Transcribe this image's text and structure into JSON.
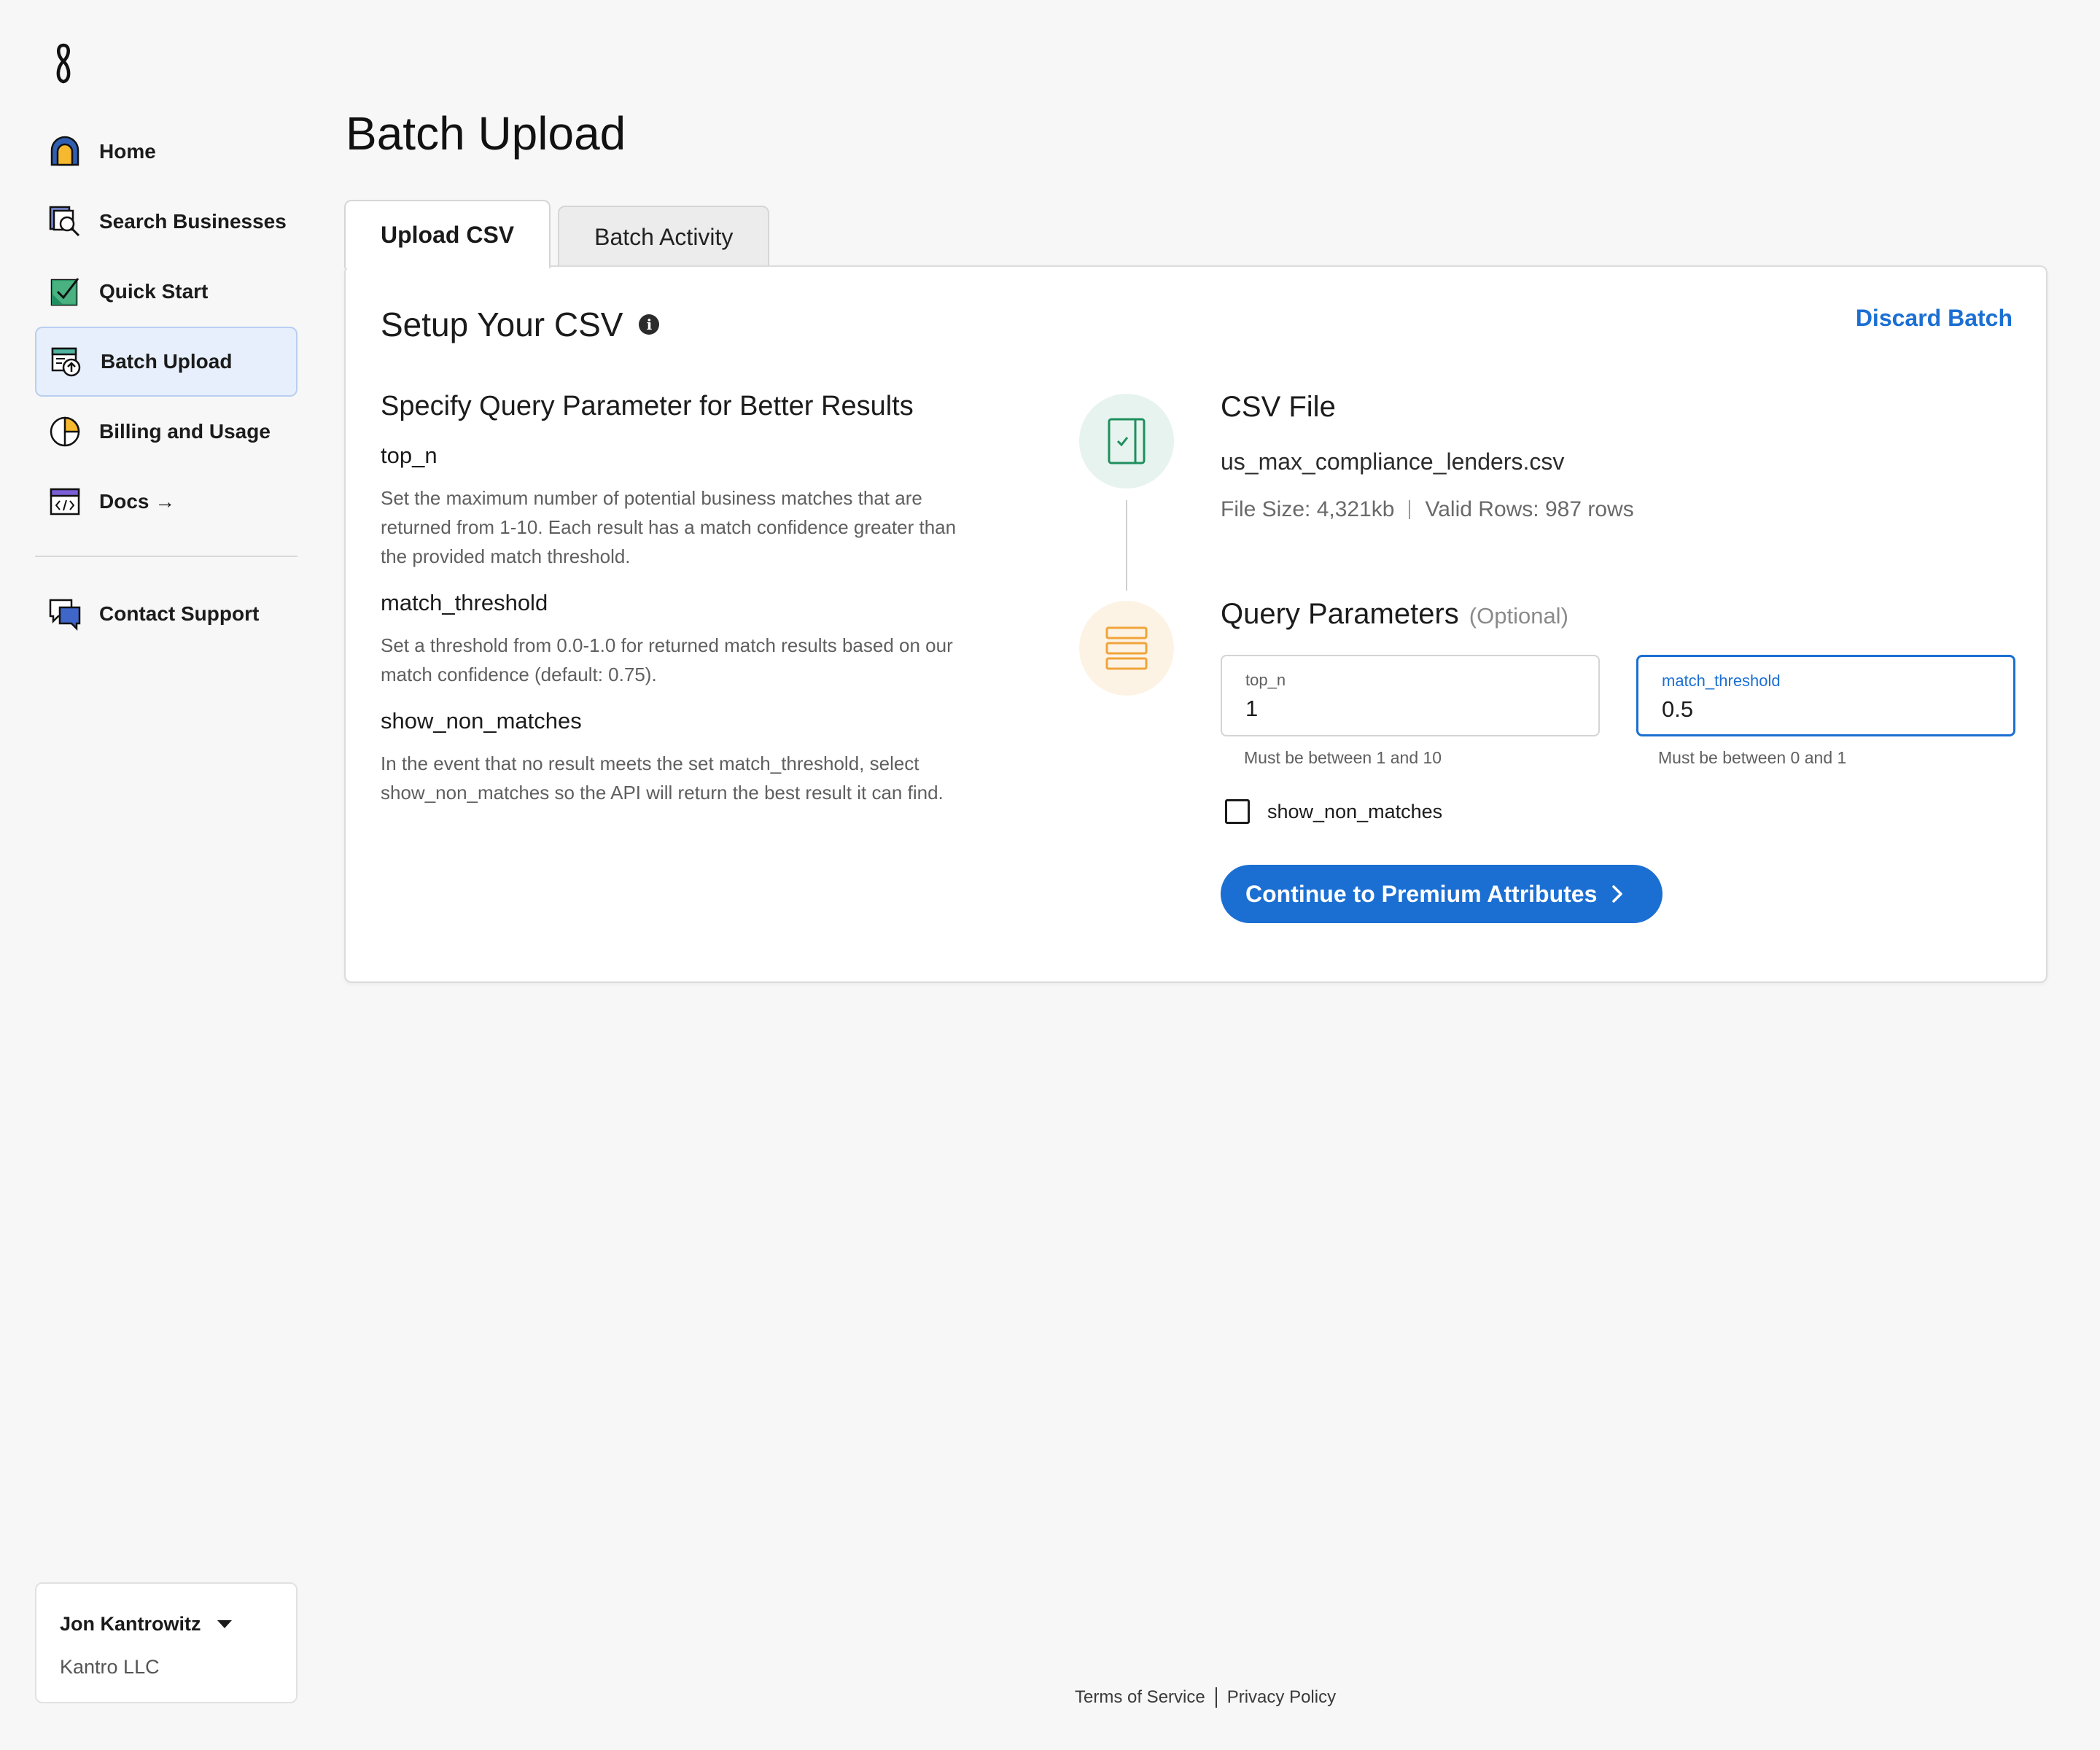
{
  "sidebar": {
    "logo_icon": "brand-logo-icon",
    "items": [
      {
        "label": "Home",
        "icon": "home-icon",
        "active": false
      },
      {
        "label": "Search Businesses",
        "icon": "search-businesses-icon",
        "active": false
      },
      {
        "label": "Quick Start",
        "icon": "quick-start-icon",
        "active": false
      },
      {
        "label": "Batch Upload",
        "icon": "batch-upload-icon",
        "active": true
      },
      {
        "label": "Billing and Usage",
        "icon": "billing-icon",
        "active": false
      },
      {
        "label": "Docs →",
        "icon": "docs-icon",
        "active": false
      }
    ],
    "support": {
      "label": "Contact Support",
      "icon": "chat-icon"
    },
    "account": {
      "name": "Jon Kantrowitz",
      "org": "Kantro LLC"
    }
  },
  "main": {
    "title": "Batch Upload",
    "tabs": [
      {
        "label": "Upload CSV",
        "active": true
      },
      {
        "label": "Batch Activity",
        "active": false
      }
    ],
    "card": {
      "title": "Setup Your CSV",
      "discard_label": "Discard Batch",
      "left": {
        "heading": "Specify Query Parameter for Better Results",
        "params": [
          {
            "name": "top_n",
            "desc": "Set the maximum number of potential business matches that are returned from 1-10. Each result has a match confidence greater than the provided match threshold."
          },
          {
            "name": "match_threshold",
            "desc": "Set a threshold from 0.0-1.0 for returned match results based on our match confidence (default: 0.75)."
          },
          {
            "name": "show_non_matches",
            "desc": "In the event that no result meets the set match_threshold, select show_non_matches so the API will return the best result it can find."
          }
        ]
      },
      "csv": {
        "heading": "CSV File",
        "filename": "us_max_compliance_lenders.csv",
        "file_size": "File Size: 4,321kb",
        "valid_rows": "Valid Rows: 987 rows"
      },
      "query": {
        "heading": "Query Parameters",
        "optional": "(Optional)",
        "top_n": {
          "label": "top_n",
          "value": "1",
          "hint": "Must be between 1 and 10"
        },
        "match_threshold": {
          "label": "match_threshold",
          "value": "0.5",
          "hint": "Must be between 0 and 1"
        },
        "show_non_matches": {
          "label": "show_non_matches",
          "checked": false
        }
      },
      "cta_label": "Continue to Premium Attributes"
    }
  },
  "footer": {
    "terms": "Terms of Service",
    "privacy": "Privacy Policy"
  },
  "colors": {
    "accent": "#1b6fd2",
    "active_nav_bg": "#e6effb",
    "step1_bg": "#e7f3ee",
    "step2_bg": "#fdf3e4"
  }
}
